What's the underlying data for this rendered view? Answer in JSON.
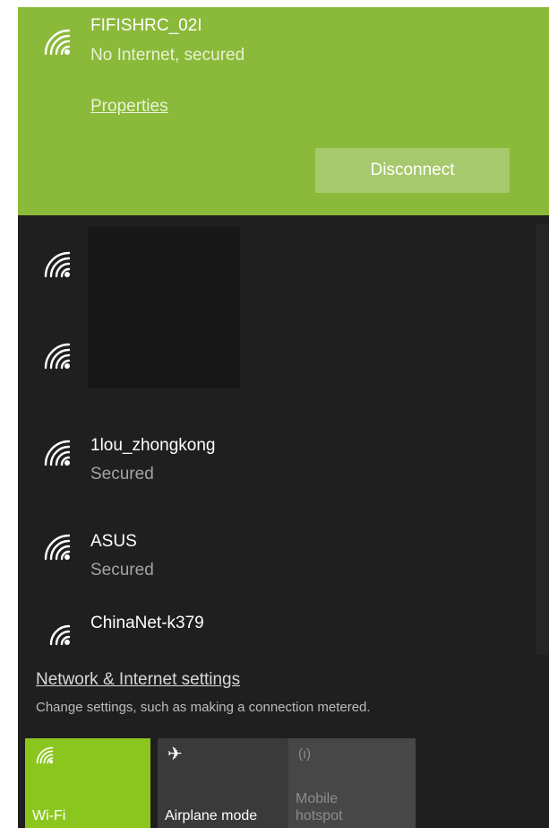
{
  "connected_network": {
    "name": "FIFISHRC_02I",
    "status": "No Internet, secured",
    "properties_label": "Properties",
    "disconnect_label": "Disconnect",
    "icon": "wifi-signal-icon"
  },
  "networks": [
    {
      "name": "1lou_zhongkong",
      "status": "Secured",
      "icon": "wifi-signal-icon"
    },
    {
      "name": "ASUS",
      "status": "Secured",
      "icon": "wifi-signal-icon"
    },
    {
      "name": "ChinaNet-k379",
      "status": "",
      "icon": "wifi-weak-signal-icon"
    }
  ],
  "settings": {
    "link": "Network & Internet settings",
    "description": "Change settings, such as making a connection metered."
  },
  "quick_actions": [
    {
      "label": "Wi-Fi",
      "icon": "wifi-icon",
      "state": "on"
    },
    {
      "label": "Airplane mode",
      "icon": "airplane-icon",
      "state": "off"
    },
    {
      "label": "Mobile hotspot",
      "icon": "hotspot-icon",
      "state": "disabled"
    }
  ],
  "colors": {
    "accent": "#8bb93a",
    "tile_on": "#8bc61f",
    "background": "#1f1f1f"
  }
}
